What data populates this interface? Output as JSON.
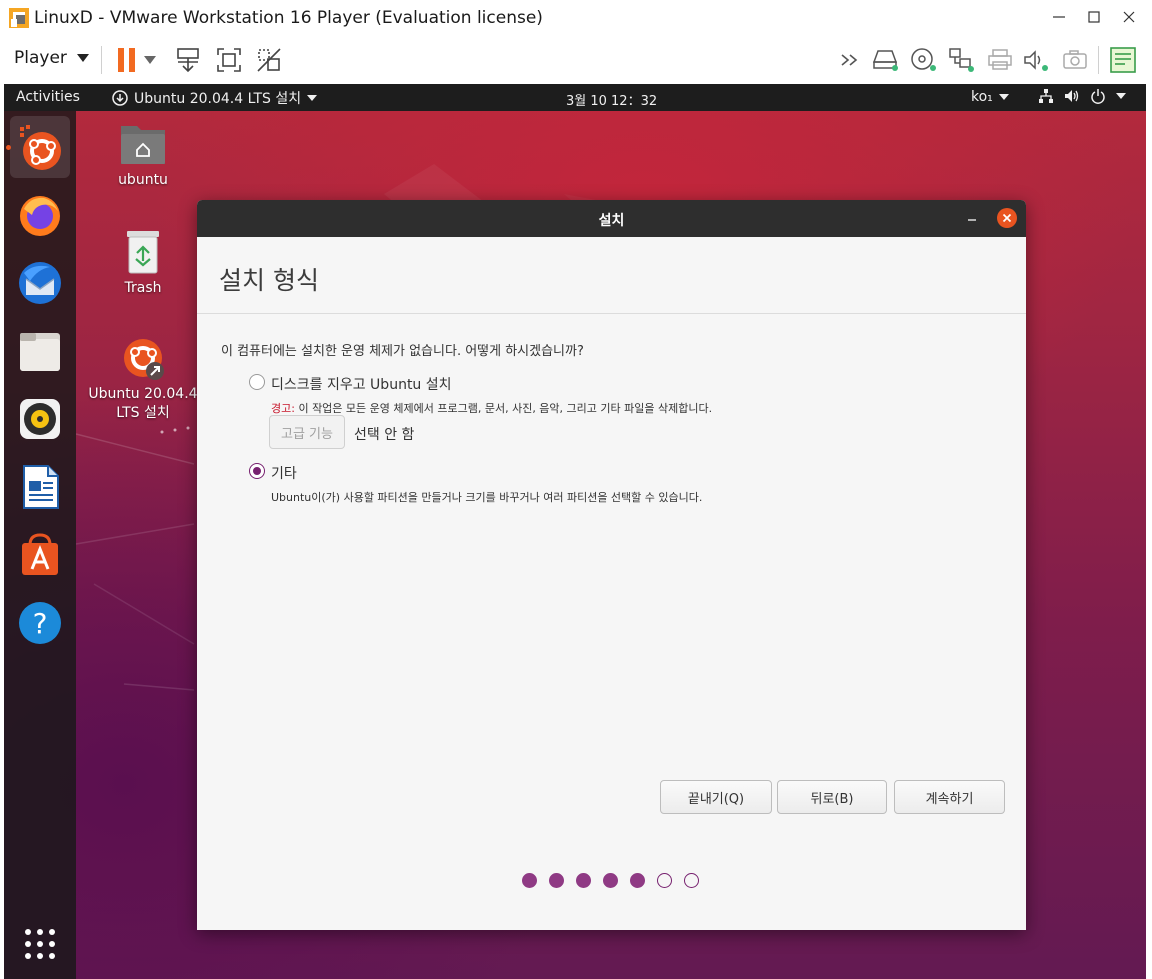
{
  "window": {
    "title": "LinuxD - VMware Workstation 16 Player (Evaluation license)",
    "icon": "vmware-player-icon"
  },
  "toolbar": {
    "player_label": "Player",
    "icons": [
      "pause-icon",
      "send-ctrl-alt-del-icon",
      "fullscreen-icon",
      "unity-icon",
      "more-icon",
      "hard-disk-icon",
      "cd-dvd-icon",
      "network-icon",
      "printer-icon",
      "sound-icon",
      "camera-icon",
      "notes-icon"
    ]
  },
  "guest": {
    "topbar": {
      "activities": "Activities",
      "app_menu": "Ubuntu 20.04.4 LTS 설치",
      "clock": "3월 10  12：32",
      "language": "ko₁"
    },
    "desktop_icons": [
      {
        "label": "ubuntu",
        "icon": "home-folder-icon"
      },
      {
        "label": "Trash",
        "icon": "trash-icon"
      },
      {
        "label": "Ubuntu 20.04.4 LTS 설치",
        "icon": "ubuntu-installer-icon"
      }
    ],
    "dock_items": [
      "ubuntu-installer-icon",
      "firefox-icon",
      "thunderbird-icon",
      "files-icon",
      "rhythmbox-icon",
      "libreoffice-writer-icon",
      "software-center-icon",
      "help-icon",
      "show-apps-icon"
    ]
  },
  "installer": {
    "window_title": "설치",
    "heading": "설치 형식",
    "question": "이 컴퓨터에는 설치한 운영 체제가 없습니다. 어떻게 하시겠습니까?",
    "option_erase": {
      "label": "디스크를 지우고 Ubuntu 설치",
      "warning_prefix": "경고:",
      "warning_text": " 이 작업은 모든 운영 체제에서 프로그램, 문서, 사진, 음악, 그리고 기타 파일을 삭제합니다.",
      "advanced_button": "고급 기능",
      "advanced_status": "선택 안 함",
      "selected": false
    },
    "option_other": {
      "label": "기타",
      "description": "Ubuntu이(가) 사용할 파티션을 만들거나 크기를 바꾸거나 여러 파티션을 선택할 수 있습니다.",
      "selected": true
    },
    "buttons": {
      "quit": "끝내기(Q)",
      "back": "뒤로(B)",
      "continue": "계속하기"
    },
    "progress": {
      "total_steps": 7,
      "completed_steps": 5
    }
  }
}
